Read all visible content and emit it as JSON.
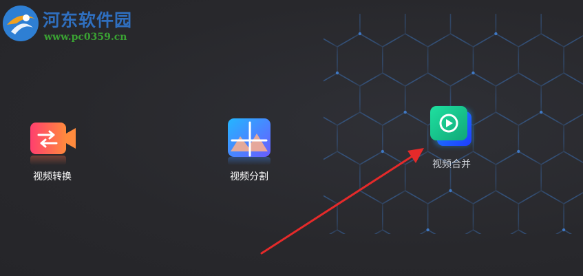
{
  "watermark": {
    "title": "河东软件园",
    "url": "www.pc0359.cn"
  },
  "features": [
    {
      "label": "视频转换",
      "icon": "video-convert-icon"
    },
    {
      "label": "视频分割",
      "icon": "video-split-icon"
    },
    {
      "label": "视频合并",
      "icon": "video-merge-icon"
    }
  ],
  "colors": {
    "background": "#2a2a2e",
    "hex_lines": "#3d6fb0",
    "watermark_title": "#2f6fbf",
    "watermark_url": "#3aa233",
    "arrow": "#e52a2a",
    "convert_gradient": [
      "#ff3f6e",
      "#ff8a3d"
    ],
    "split_gradient": [
      "#2aa6ff",
      "#7d5cff"
    ],
    "merge_gradient": [
      "#1dd49a",
      "#1a7cff"
    ]
  }
}
